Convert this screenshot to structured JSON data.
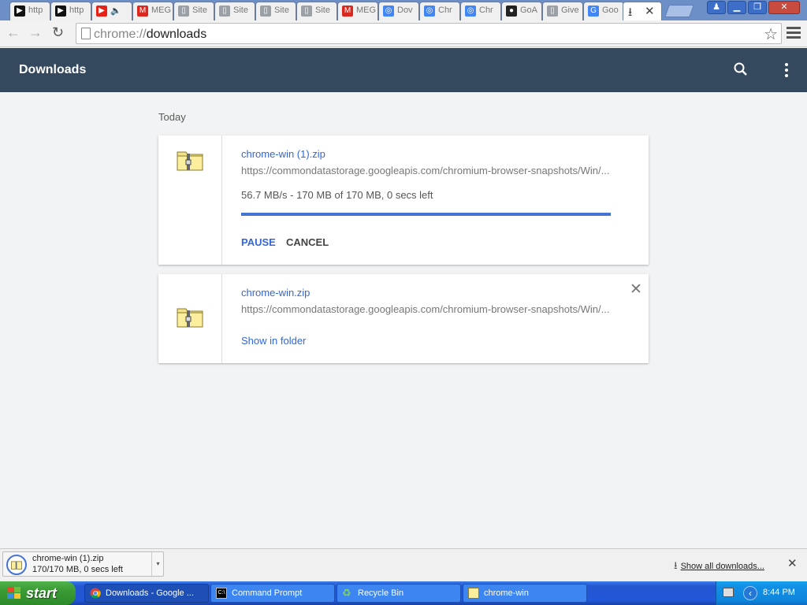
{
  "browser": {
    "tabs": [
      {
        "title": "http",
        "color": "#111111",
        "glyph": "▶"
      },
      {
        "title": "http",
        "color": "#111111",
        "glyph": "▶"
      },
      {
        "title": "",
        "color": "#e62117",
        "glyph": "▶",
        "audio": "🔈"
      },
      {
        "title": "MEG",
        "color": "#d9281e",
        "glyph": "M"
      },
      {
        "title": "Site",
        "color": "#9aa0a6",
        "glyph": "▯"
      },
      {
        "title": "Site",
        "color": "#9aa0a6",
        "glyph": "▯"
      },
      {
        "title": "Site",
        "color": "#9aa0a6",
        "glyph": "▯"
      },
      {
        "title": "Site",
        "color": "#9aa0a6",
        "glyph": "▯"
      },
      {
        "title": "MEG",
        "color": "#d9281e",
        "glyph": "M"
      },
      {
        "title": "Dov",
        "color": "#4285f4",
        "glyph": "◎"
      },
      {
        "title": "Chr",
        "color": "#4285f4",
        "glyph": "◎"
      },
      {
        "title": "Chr",
        "color": "#4285f4",
        "glyph": "◎"
      },
      {
        "title": "GoA",
        "color": "#222222",
        "glyph": "●"
      },
      {
        "title": "Give",
        "color": "#9aa0a6",
        "glyph": "▯"
      },
      {
        "title": "Goo",
        "color": "#4285f4",
        "glyph": "G"
      }
    ],
    "active_tab": {
      "icon": "download-icon",
      "close": "✕"
    },
    "address": {
      "scheme": "chrome://",
      "path": "downloads"
    }
  },
  "page": {
    "title": "Downloads",
    "section": "Today",
    "downloads": [
      {
        "filename": "chrome-win (1).zip",
        "url": "https://commondatastorage.googleapis.com/chromium-browser-snapshots/Win/...",
        "status": "56.7 MB/s - 170 MB of 170 MB, 0 secs left",
        "progress": 1.0,
        "actions": {
          "pause": "PAUSE",
          "cancel": "CANCEL"
        }
      },
      {
        "filename": "chrome-win.zip",
        "url": "https://commondatastorage.googleapis.com/chromium-browser-snapshots/Win/...",
        "link": "Show in folder"
      }
    ]
  },
  "shelf": {
    "item_name": "chrome-win (1).zip",
    "item_status": "170/170 MB, 0 secs left",
    "show_all": "Show all downloads..."
  },
  "taskbar": {
    "start": "start",
    "buttons": [
      {
        "label": "Downloads - Google ...",
        "icon": "chrome-icon"
      },
      {
        "label": "Command Prompt",
        "icon": "cmd-icon"
      },
      {
        "label": "Recycle Bin",
        "icon": "recycle-bin-icon"
      },
      {
        "label": "chrome-win",
        "icon": "zip-folder-icon"
      }
    ],
    "clock": "8:44 PM"
  },
  "colors": {
    "header": "#34495e",
    "link": "#3367d6",
    "progress": "#4674d4"
  }
}
